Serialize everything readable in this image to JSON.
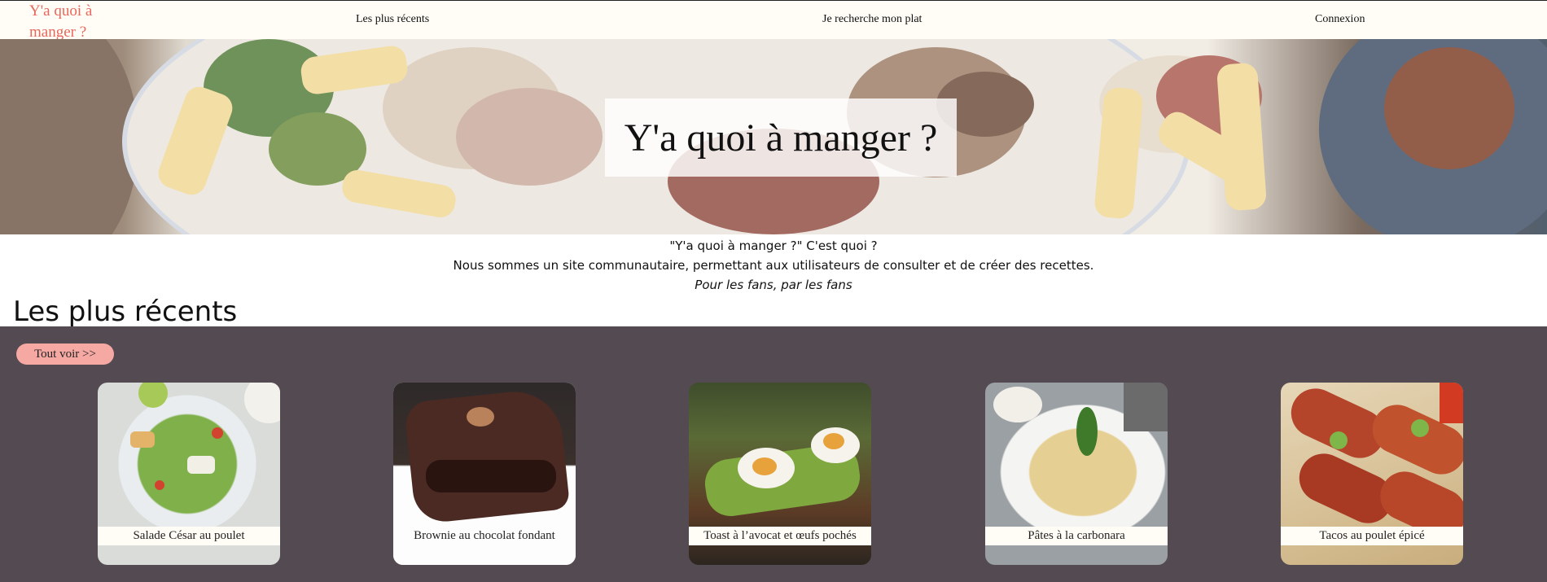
{
  "nav": {
    "logo": "Y'a quoi à manger ?",
    "links": [
      "Les plus récents",
      "Je recherche mon plat",
      "Connexion"
    ]
  },
  "hero": {
    "title": "Y'a quoi à manger ?"
  },
  "about": {
    "question": "\"Y'a quoi à manger ?\" C'est quoi ?",
    "description": "Nous sommes un site communautaire, permettant aux utilisateurs de consulter et de créer des recettes.",
    "tagline": "Pour les fans, par les fans"
  },
  "recent": {
    "title": "Les plus récents",
    "see_all": "Tout voir >>",
    "cards": [
      {
        "name": "Salade César au poulet"
      },
      {
        "name": "Brownie au chocolat fondant"
      },
      {
        "name": "Toast à l’avocat et œufs pochés"
      },
      {
        "name": "Pâtes à la carbonara"
      },
      {
        "name": "Tacos au poulet épicé"
      }
    ]
  },
  "colors": {
    "logo": "#e8675d",
    "nav_bg": "#fffdf6",
    "section_bg": "#544b52",
    "button_bg": "#f6a8a3"
  }
}
